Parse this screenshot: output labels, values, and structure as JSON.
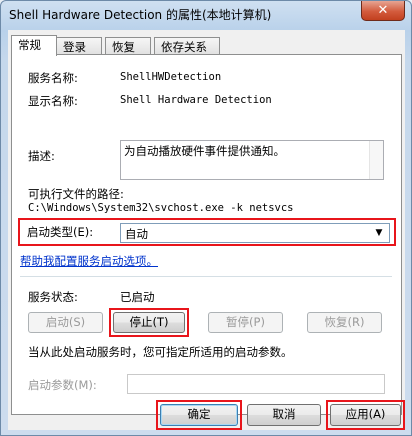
{
  "window": {
    "title": "Shell Hardware Detection 的属性(本地计算机)",
    "close_glyph": "✕"
  },
  "tabs": [
    {
      "label": "常规",
      "active": true
    },
    {
      "label": "登录",
      "active": false
    },
    {
      "label": "恢复",
      "active": false
    },
    {
      "label": "依存关系",
      "active": false
    }
  ],
  "general": {
    "service_name_label": "服务名称:",
    "service_name_value": "ShellHWDetection",
    "display_name_label": "显示名称:",
    "display_name_value": "Shell Hardware Detection",
    "description_label": "描述:",
    "description_value": "为自动播放硬件事件提供通知。",
    "exe_path_label": "可执行文件的路径:",
    "exe_path_value": "C:\\Windows\\System32\\svchost.exe -k netsvcs",
    "startup_type_label": "启动类型(E):",
    "startup_type_value": "自动",
    "help_link": "帮助我配置服务启动选项。",
    "service_status_label": "服务状态:",
    "service_status_value": "已启动",
    "start_button": "启动(S)",
    "stop_button": "停止(T)",
    "pause_button": "暂停(P)",
    "resume_button": "恢复(R)",
    "hint_text": "当从此处启动服务时，您可指定所适用的启动参数。",
    "start_params_label": "启动参数(M):",
    "start_params_value": ""
  },
  "footer": {
    "ok_button": "确定",
    "cancel_button": "取消",
    "apply_button": "应用(A)"
  },
  "colors": {
    "highlight": "#e8151b",
    "link": "#0033cc"
  }
}
